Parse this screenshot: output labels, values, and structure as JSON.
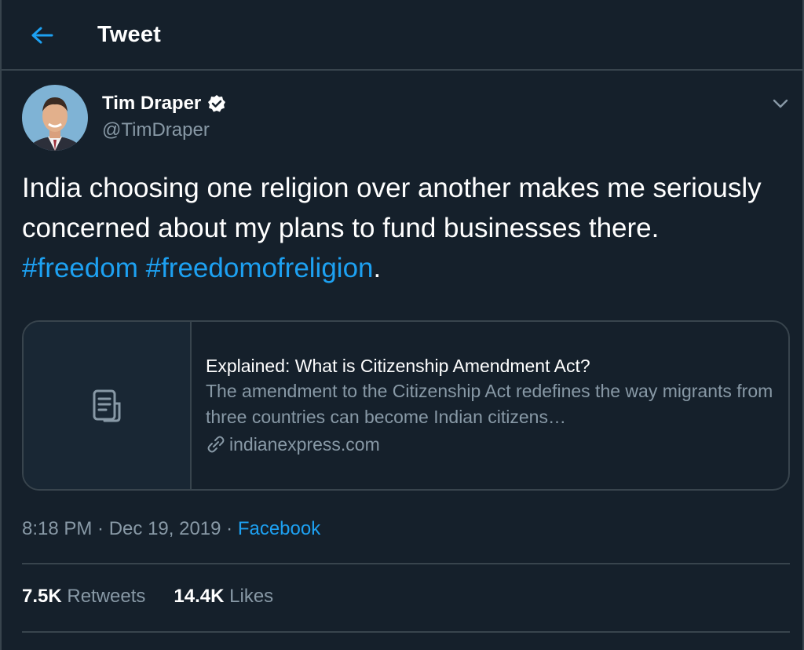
{
  "header": {
    "title": "Tweet",
    "back_icon": "arrow-left-icon"
  },
  "author": {
    "name": "Tim Draper",
    "handle": "@TimDraper",
    "verified_icon": "verified-badge-icon"
  },
  "tweet": {
    "text": "India choosing one religion over another makes me seriously concerned about my plans to fund businesses there. ",
    "hashtag_1": "#freedom",
    "hashtag_2": "#freedomofreligion",
    "trailing": "."
  },
  "card": {
    "title": "Explained: What is Citizenship Amendment Act?",
    "description": "The amendment to the Citizenship Act redefines the way migrants from three countries can become Indian citizens…",
    "domain": "indianexpress.com",
    "thumb_icon": "document-icon",
    "link_icon": "link-icon"
  },
  "meta": {
    "time": "8:18 PM",
    "date": "Dec 19, 2019",
    "source": "Facebook",
    "separator": " · "
  },
  "stats": {
    "retweets_count": "7.5K",
    "retweets_label": "Retweets",
    "likes_count": "14.4K",
    "likes_label": "Likes"
  },
  "colors": {
    "background": "#15202b",
    "accent": "#1da1f2",
    "secondary_text": "#8899a6",
    "border": "#38444d"
  }
}
